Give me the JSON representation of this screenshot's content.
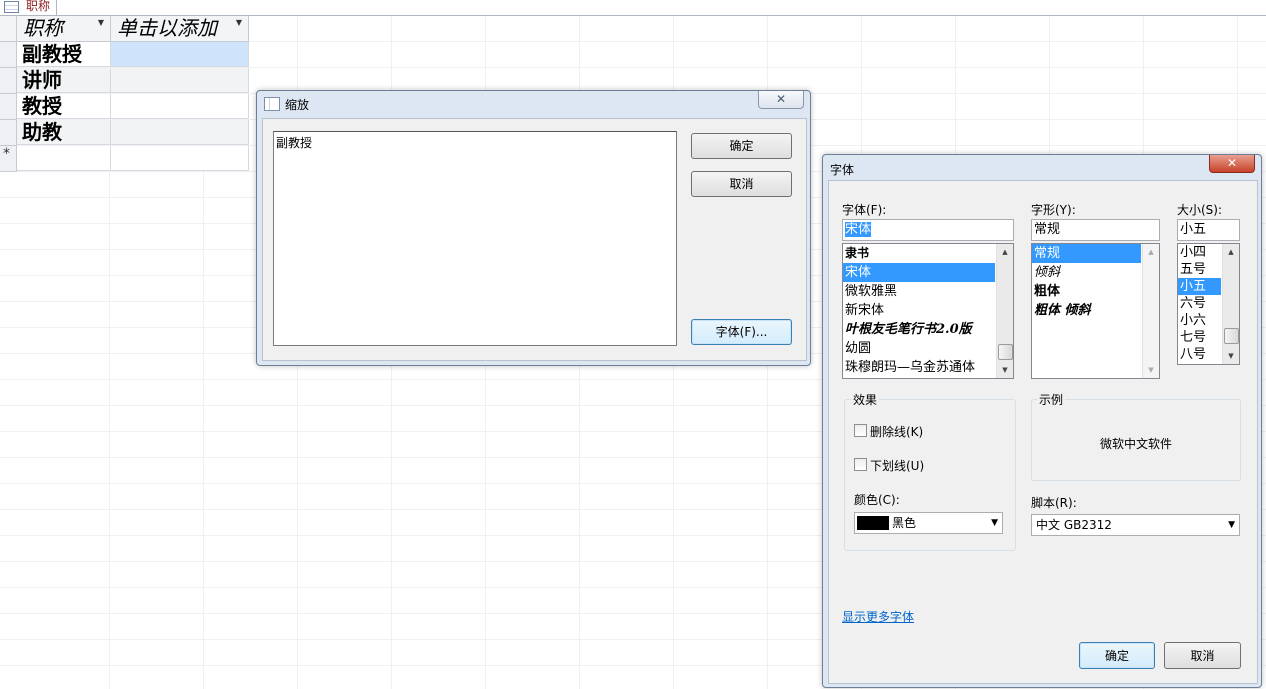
{
  "document_tab": {
    "label": "职称"
  },
  "datasheet": {
    "columns": [
      "职称",
      "单击以添加"
    ],
    "rows": [
      "副教授",
      "讲师",
      "教授",
      "助教"
    ],
    "new_row_marker": "*"
  },
  "zoom_dialog": {
    "title": "缩放",
    "close_glyph": "✕",
    "text_value": "副教授",
    "ok_label": "确定",
    "cancel_label": "取消",
    "font_label": "字体(F)..."
  },
  "font_dialog": {
    "title": "字体",
    "close_glyph": "✕",
    "font_label": "字体(F):",
    "font_value": "宋体",
    "font_list": [
      "隶书",
      "宋体",
      "微软雅黑",
      "新宋体",
      "叶根友毛笔行书2.0版",
      "幼圆",
      "珠穆朗玛—乌金苏通体"
    ],
    "font_selected": "宋体",
    "style_label": "字形(Y):",
    "style_value": "常规",
    "style_list": [
      "常规",
      "倾斜",
      "粗体",
      "粗体 倾斜"
    ],
    "style_selected": "常规",
    "size_label": "大小(S):",
    "size_value": "小五",
    "size_list": [
      "小四",
      "五号",
      "小五",
      "六号",
      "小六",
      "七号",
      "八号"
    ],
    "size_selected": "小五",
    "effects_label": "效果",
    "strikeout_label": "删除线(K)",
    "strikeout_checked": false,
    "underline_label": "下划线(U)",
    "underline_checked": false,
    "color_label": "颜色(C):",
    "color_value": "黑色",
    "color_hex": "#000000",
    "sample_label": "示例",
    "sample_text": "微软中文软件",
    "script_label": "脚本(R):",
    "script_value": "中文 GB2312",
    "more_fonts_link": "显示更多字体",
    "ok_label": "确定",
    "cancel_label": "取消"
  }
}
